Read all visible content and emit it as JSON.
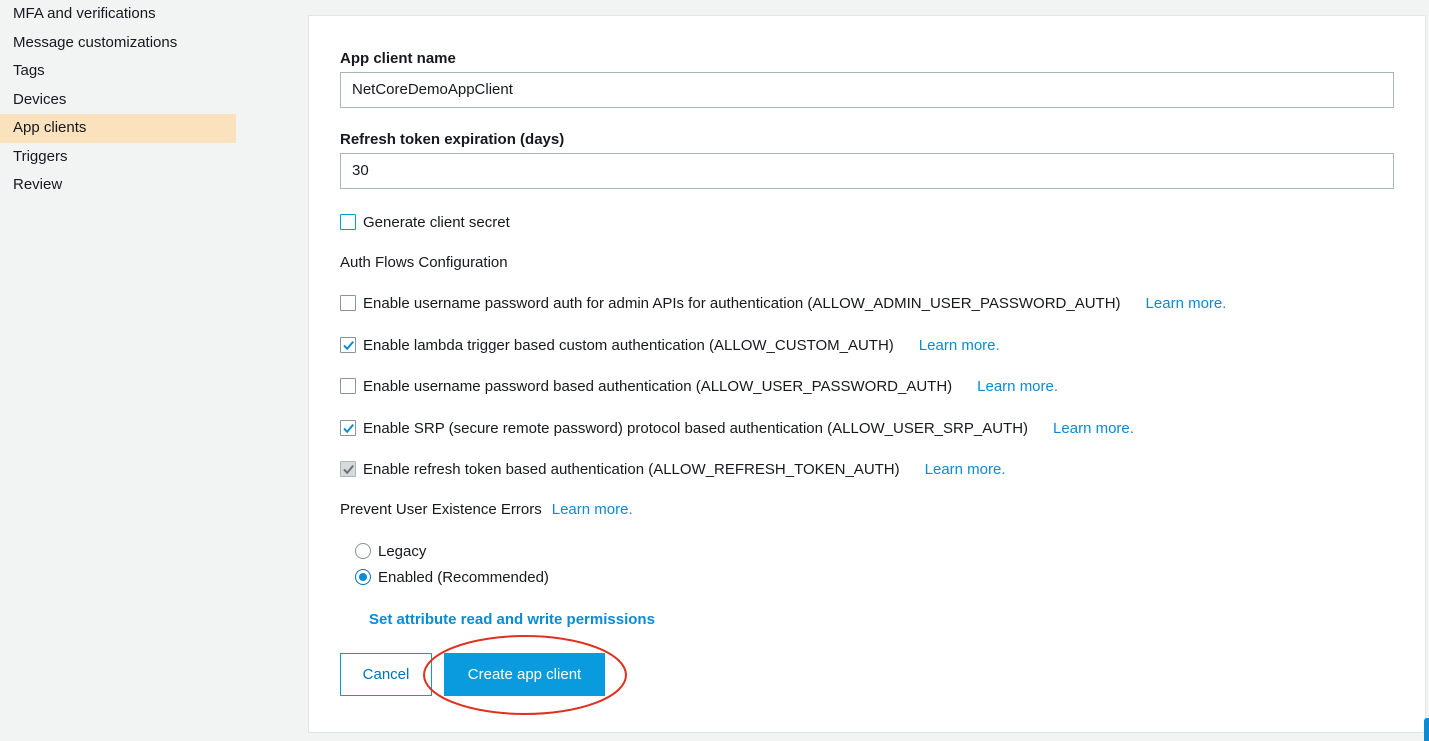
{
  "sidebar": {
    "items": [
      {
        "label": "MFA and verifications",
        "active": false
      },
      {
        "label": "Message customizations",
        "active": false
      },
      {
        "label": "Tags",
        "active": false
      },
      {
        "label": "Devices",
        "active": false
      },
      {
        "label": "App clients",
        "active": true
      },
      {
        "label": "Triggers",
        "active": false
      },
      {
        "label": "Review",
        "active": false
      }
    ]
  },
  "form": {
    "app_client_name_label": "App client name",
    "app_client_name_value": "NetCoreDemoAppClient",
    "refresh_label": "Refresh token expiration (days)",
    "refresh_value": "30",
    "generate_secret_label": "Generate client secret",
    "generate_secret_checked": false,
    "auth_flows_title": "Auth Flows Configuration",
    "auth_flows": [
      {
        "label": "Enable username password auth for admin APIs for authentication (ALLOW_ADMIN_USER_PASSWORD_AUTH)",
        "checked": false,
        "learn": "Learn more."
      },
      {
        "label": "Enable lambda trigger based custom authentication (ALLOW_CUSTOM_AUTH)",
        "checked": true,
        "learn": "Learn more."
      },
      {
        "label": "Enable username password based authentication (ALLOW_USER_PASSWORD_AUTH)",
        "checked": false,
        "learn": "Learn more."
      },
      {
        "label": "Enable SRP (secure remote password) protocol based authentication (ALLOW_USER_SRP_AUTH)",
        "checked": true,
        "learn": "Learn more."
      },
      {
        "label": "Enable refresh token based authentication (ALLOW_REFRESH_TOKEN_AUTH)",
        "checked": true,
        "locked": true,
        "learn": "Learn more."
      }
    ],
    "prevent_errors_label": "Prevent User Existence Errors",
    "prevent_errors_learn": "Learn more.",
    "radio_options": [
      {
        "label": "Legacy",
        "selected": false
      },
      {
        "label": "Enabled (Recommended)",
        "selected": true
      }
    ],
    "attr_permissions_link": "Set attribute read and write permissions",
    "cancel_label": "Cancel",
    "create_label": "Create app client"
  },
  "colors": {
    "accent": "#0a8bd6",
    "active_nav": "#fae2bd",
    "annotation": "#e0301e"
  }
}
